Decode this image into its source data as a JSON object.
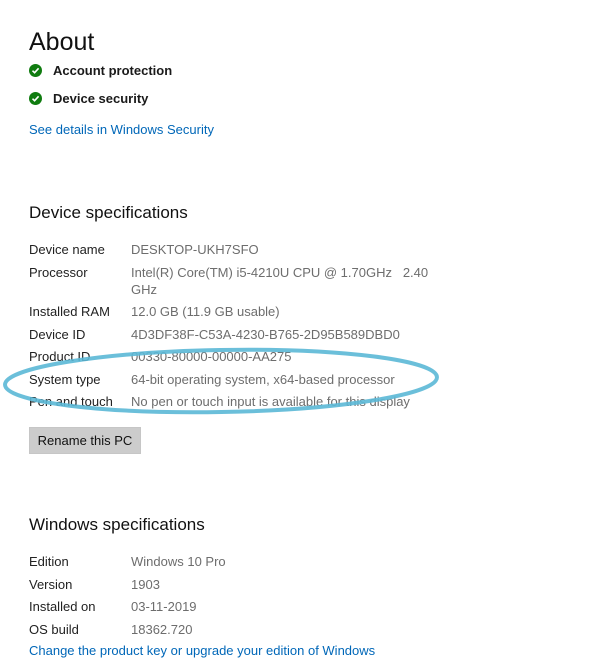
{
  "about": {
    "title": "About",
    "security_items": [
      {
        "label": "Account protection",
        "icon": "check-icon"
      },
      {
        "label": "Device security",
        "icon": "check-icon"
      }
    ],
    "security_link": "See details in Windows Security"
  },
  "device_specs": {
    "title": "Device specifications",
    "rows": [
      {
        "label": "Device name",
        "value": "DESKTOP-UKH7SFO"
      },
      {
        "label": "Processor",
        "value": "Intel(R) Core(TM) i5-4210U CPU @ 1.70GHz   2.40 GHz"
      },
      {
        "label": "Installed RAM",
        "value": "12.0 GB (11.9 GB usable)"
      },
      {
        "label": "Device ID",
        "value": "4D3DF38F-C53A-4230-B765-2D95B589DBD0"
      },
      {
        "label": "Product ID",
        "value": "00330-80000-00000-AA275"
      },
      {
        "label": "System type",
        "value": "64-bit operating system, x64-based processor"
      },
      {
        "label": "Pen and touch",
        "value": "No pen or touch input is available for this display"
      }
    ],
    "rename_button": "Rename this PC"
  },
  "windows_specs": {
    "title": "Windows specifications",
    "rows": [
      {
        "label": "Edition",
        "value": "Windows 10 Pro"
      },
      {
        "label": "Version",
        "value": "1903"
      },
      {
        "label": "Installed on",
        "value": "03-11-2019"
      },
      {
        "label": "OS build",
        "value": "18362.720"
      }
    ],
    "product_key_link": "Change the product key or upgrade your edition of Windows"
  },
  "colors": {
    "accent_link": "#0067b8",
    "check_green": "#107c10",
    "highlight_ellipse": "#5bb8d6",
    "button_bg": "#cccccc"
  }
}
